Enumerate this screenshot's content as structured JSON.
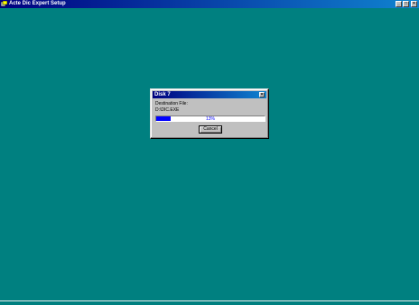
{
  "window": {
    "title": "Acte Dic Expert Setup",
    "icon": "setup-app-icon",
    "buttons": {
      "minimize": "_",
      "maximize": "□",
      "close": "×"
    }
  },
  "dialog": {
    "title": "Disk 7",
    "close_label": "×",
    "destination_label": "Destination File:",
    "destination_path": "D:\\DIC.EXE",
    "progress": {
      "percent": 13,
      "text": "13%"
    },
    "cancel_label": "Cancel"
  },
  "colors": {
    "desktop": "#008080",
    "titlebar": "#000080",
    "progress_fill": "#0000ff"
  }
}
